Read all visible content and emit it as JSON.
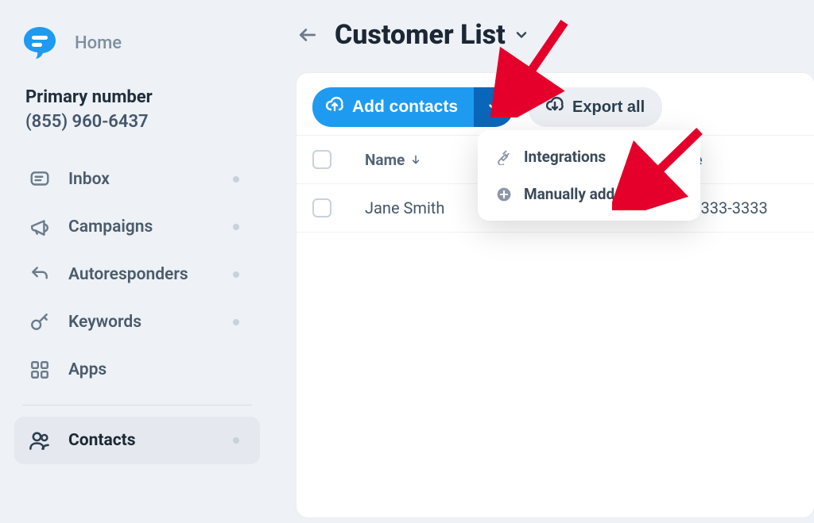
{
  "sidebar": {
    "home_label": "Home",
    "primary_label": "Primary number",
    "primary_number": "(855) 960-6437",
    "items": [
      {
        "label": "Inbox",
        "has_dot": true
      },
      {
        "label": "Campaigns",
        "has_dot": true
      },
      {
        "label": "Autoresponders",
        "has_dot": true
      },
      {
        "label": "Keywords",
        "has_dot": true
      },
      {
        "label": "Apps",
        "has_dot": false
      }
    ],
    "contacts_label": "Contacts"
  },
  "header": {
    "title": "Customer List"
  },
  "toolbar": {
    "add_contacts_label": "Add contacts",
    "export_all_label": "Export all"
  },
  "dropdown": {
    "integrations_label": "Integrations",
    "manual_add_label": "Manually add contact"
  },
  "table": {
    "columns": {
      "name": "Name",
      "phone": "Phone"
    },
    "rows": [
      {
        "name": "Jane Smith",
        "phone": "(333) 333-3333"
      }
    ]
  }
}
